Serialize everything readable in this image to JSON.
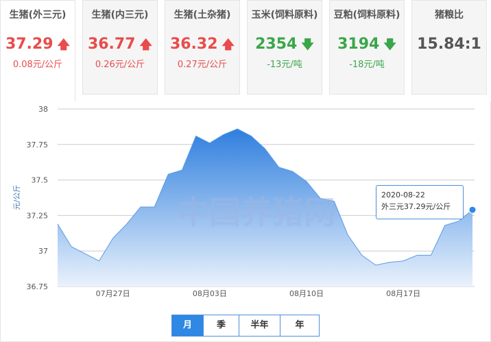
{
  "cards": [
    {
      "title": "生猪(外三元)",
      "price": "37.29",
      "change": "0.08元/公斤",
      "direction": "up",
      "arrow": "🡅"
    },
    {
      "title": "生猪(内三元)",
      "price": "36.77",
      "change": "0.26元/公斤",
      "direction": "up",
      "arrow": "🡅"
    },
    {
      "title": "生猪(土杂猪)",
      "price": "36.32",
      "change": "0.27元/公斤",
      "direction": "up",
      "arrow": "🡅"
    },
    {
      "title": "玉米(饲料原料)",
      "price": "2354",
      "change": "-13元/吨",
      "direction": "down",
      "arrow": "🡇"
    },
    {
      "title": "豆粕(饲料原料)",
      "price": "3194",
      "change": "-18元/吨",
      "direction": "down",
      "arrow": "🡇"
    },
    {
      "title": "猪粮比",
      "price": "15.84:1",
      "change": "",
      "direction": "neutral",
      "arrow": ""
    }
  ],
  "colors": {
    "up": "#e84c4c",
    "down": "#3aa64a",
    "accent": "#2f88e3",
    "area_top": "#2f7fde",
    "area_bottom": "#eaf2fc"
  },
  "tooltip": {
    "date": "2020-08-22",
    "value": "外三元37.29元/公斤"
  },
  "watermark": "中国养猪网",
  "range_tabs": [
    "月",
    "季",
    "半年",
    "年"
  ],
  "range_active": 0,
  "chart_data": {
    "type": "area",
    "x": [
      "07-23",
      "07-24",
      "07-25",
      "07-26",
      "07-27",
      "07-28",
      "07-29",
      "07-30",
      "07-31",
      "08-01",
      "08-02",
      "08-03",
      "08-04",
      "08-05",
      "08-06",
      "08-07",
      "08-08",
      "08-09",
      "08-10",
      "08-11",
      "08-12",
      "08-13",
      "08-14",
      "08-15",
      "08-16",
      "08-17",
      "08-18",
      "08-19",
      "08-20",
      "08-21",
      "08-22"
    ],
    "values": [
      37.19,
      37.03,
      36.98,
      36.93,
      37.09,
      37.19,
      37.31,
      37.31,
      37.54,
      37.57,
      37.81,
      37.76,
      37.82,
      37.86,
      37.81,
      37.72,
      37.59,
      37.56,
      37.49,
      37.37,
      37.35,
      37.11,
      36.97,
      36.9,
      36.92,
      36.93,
      36.97,
      36.97,
      37.18,
      37.21,
      37.29
    ],
    "xticks": [
      {
        "label": "07月27日",
        "at": "07-27"
      },
      {
        "label": "08月03日",
        "at": "08-03"
      },
      {
        "label": "08月10日",
        "at": "08-10"
      },
      {
        "label": "08月17日",
        "at": "08-17"
      }
    ],
    "yticks": [
      "38",
      "37.75",
      "37.5",
      "37.25",
      "37",
      "36.75"
    ],
    "ylim": [
      36.75,
      38
    ],
    "ylabel": "元/公斤",
    "xlabel": "",
    "grid": true,
    "highlight_index": 30
  }
}
